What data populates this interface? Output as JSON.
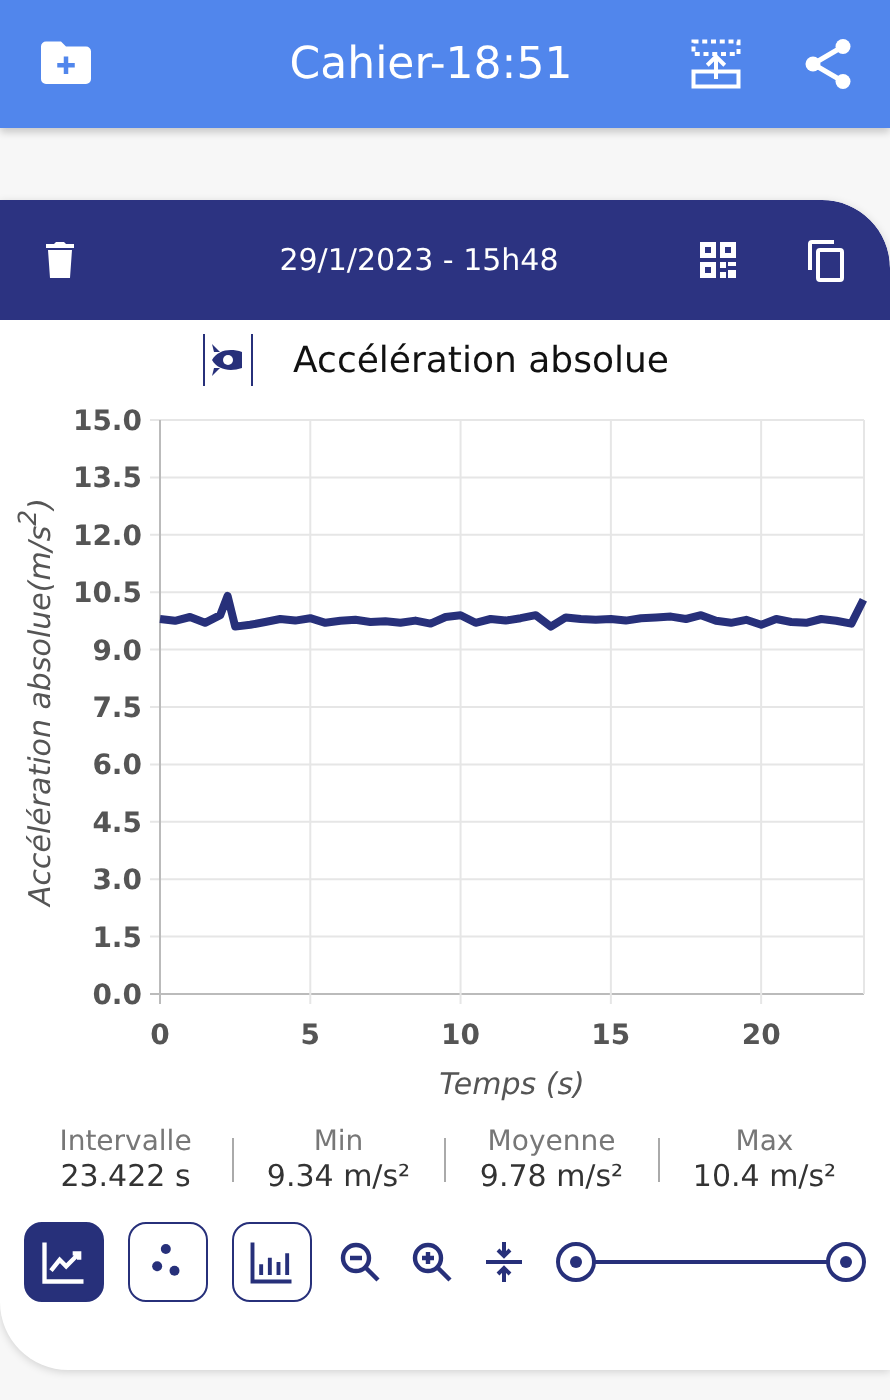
{
  "app_bar": {
    "title": "Cahier-18:51"
  },
  "card": {
    "date": "29/1/2023 - 15h48",
    "sensor_title": "Accélération absolue",
    "chart_data": {
      "type": "line",
      "xlabel": "Temps (s)",
      "ylabel": "Accélération absolue(m/s$^{2}$)",
      "grid": true,
      "xlim": [
        0,
        23.422
      ],
      "ylim": [
        0,
        15
      ],
      "xticks": [
        0,
        5,
        10,
        15,
        20
      ],
      "yticks": [
        {
          "value": 0,
          "label": "0.0"
        },
        {
          "value": 1.5,
          "label": "1.5"
        },
        {
          "value": 3,
          "label": "3.0"
        },
        {
          "value": 4.5,
          "label": "4.5"
        },
        {
          "value": 6,
          "label": "6.0"
        },
        {
          "value": 7.5,
          "label": "7.5"
        },
        {
          "value": 9,
          "label": "9.0"
        },
        {
          "value": 10.5,
          "label": "10.5"
        },
        {
          "value": 12,
          "label": "12.0"
        },
        {
          "value": 13.5,
          "label": "13.5"
        },
        {
          "value": 15,
          "label": "15.0"
        }
      ],
      "x": [
        0,
        0.5,
        1,
        1.5,
        2,
        2.25,
        2.5,
        3,
        3.5,
        4,
        4.5,
        5,
        5.5,
        6,
        6.5,
        7,
        7.5,
        8,
        8.5,
        9,
        9.5,
        10,
        10.5,
        11,
        11.5,
        12,
        12.5,
        13,
        13.5,
        14,
        14.5,
        15,
        15.5,
        16,
        16.5,
        17,
        17.5,
        18,
        18.5,
        19,
        19.5,
        20,
        20.5,
        21,
        21.5,
        22,
        22.5,
        23,
        23.4
      ],
      "series": [
        {
          "color": "#27307a",
          "values": [
            9.8,
            9.75,
            9.85,
            9.7,
            9.9,
            10.4,
            9.6,
            9.65,
            9.72,
            9.8,
            9.76,
            9.82,
            9.7,
            9.75,
            9.78,
            9.72,
            9.74,
            9.7,
            9.76,
            9.68,
            9.85,
            9.9,
            9.7,
            9.8,
            9.76,
            9.82,
            9.9,
            9.6,
            9.84,
            9.8,
            9.78,
            9.8,
            9.76,
            9.82,
            9.84,
            9.86,
            9.8,
            9.9,
            9.75,
            9.7,
            9.78,
            9.65,
            9.8,
            9.72,
            9.7,
            9.8,
            9.75,
            9.68,
            10.3
          ]
        }
      ]
    },
    "stats": [
      {
        "label": "Intervalle",
        "value": "23.422 s"
      },
      {
        "label": "Min",
        "value": "9.34 m/s²"
      },
      {
        "label": "Moyenne",
        "value": "9.78 m/s²"
      },
      {
        "label": "Max",
        "value": "10.4 m/s²"
      }
    ],
    "modes": [
      {
        "kind": "line",
        "selected": true
      },
      {
        "kind": "scatter",
        "selected": false
      },
      {
        "kind": "bar",
        "selected": false
      }
    ],
    "range_slider": {
      "thumbs": [
        {
          "level": 0
        },
        {
          "level": 1
        }
      ]
    }
  }
}
